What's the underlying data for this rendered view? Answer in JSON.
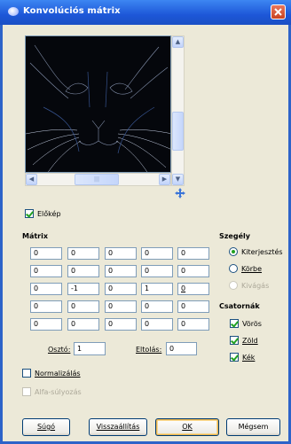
{
  "window": {
    "title": "Konvolúciós mátrix"
  },
  "preview": {
    "checkbox_label": "Előkép",
    "checked": true,
    "vscroll_up": "▲",
    "vscroll_down": "▼",
    "hscroll_left": "◀",
    "hscroll_right": "▶",
    "hscroll_grip": "|||"
  },
  "matrix": {
    "heading": "Mátrix",
    "rows": [
      [
        "0",
        "0",
        "0",
        "0",
        "0"
      ],
      [
        "0",
        "0",
        "0",
        "0",
        "0"
      ],
      [
        "0",
        "-1",
        "0",
        "1",
        "0"
      ],
      [
        "0",
        "0",
        "0",
        "0",
        "0"
      ],
      [
        "0",
        "0",
        "0",
        "0",
        "0"
      ]
    ],
    "divisor_label": "Osztó:",
    "divisor_value": "1",
    "offset_label": "Eltolás:",
    "offset_value": "0"
  },
  "options": {
    "normalize_label": "Normalizálás",
    "normalize_checked": false,
    "alpha_label": "Alfa-súlyozás",
    "alpha_checked": false
  },
  "border": {
    "heading": "Szegély",
    "options": [
      {
        "label": "Kiterjesztés",
        "selected": true,
        "enabled": true
      },
      {
        "label": "Körbe",
        "selected": false,
        "enabled": true
      },
      {
        "label": "Kivágás",
        "selected": false,
        "enabled": false
      }
    ]
  },
  "channels": {
    "heading": "Csatornák",
    "items": [
      {
        "label": "Vörös",
        "checked": true
      },
      {
        "label": "Zöld",
        "checked": true
      },
      {
        "label": "Kék",
        "checked": true
      }
    ]
  },
  "buttons": {
    "help": "Súgó",
    "reset": "Visszaállítás",
    "ok": "OK",
    "cancel": "Mégsem"
  },
  "colors": {
    "title_bar": "#1d57d8",
    "dialog_bg": "#ece9d8",
    "close_button": "#d4532f"
  }
}
